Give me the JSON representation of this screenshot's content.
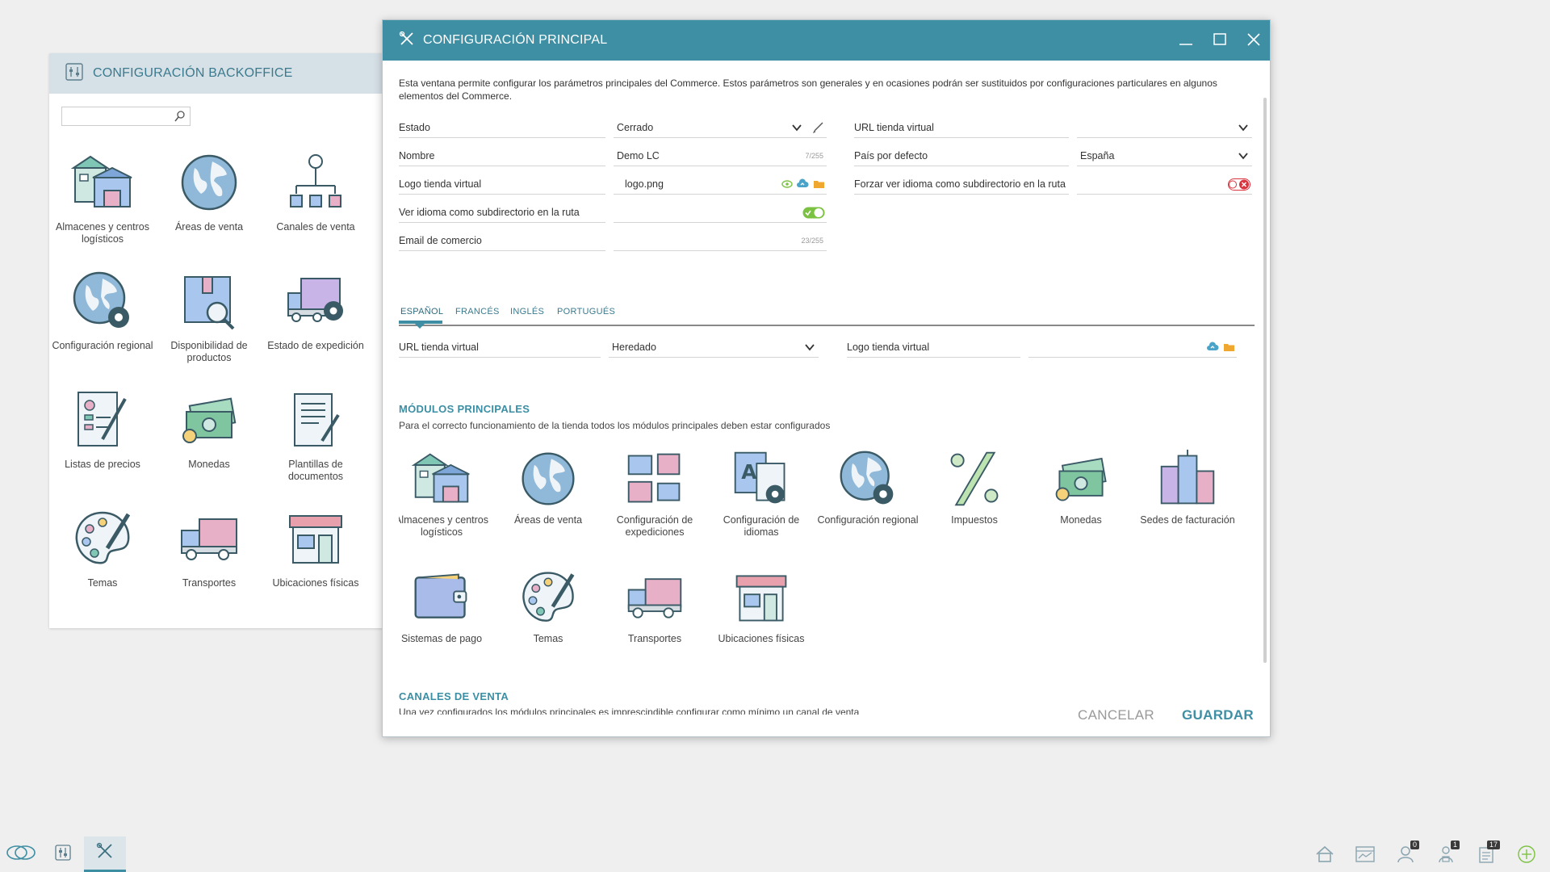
{
  "backoffice": {
    "title": "CONFIGURACIÓN BACKOFFICE",
    "search_placeholder": "",
    "items": [
      {
        "label": "Almacenes y centros logísticos",
        "icon": "warehouse-icon"
      },
      {
        "label": "Áreas de venta",
        "icon": "globe-icon"
      },
      {
        "label": "Canales de venta",
        "icon": "channels-icon"
      },
      {
        "label": "Configuración regional",
        "icon": "globe-gear-icon"
      },
      {
        "label": "Disponibilidad de productos",
        "icon": "box-search-icon"
      },
      {
        "label": "Estado de expedición",
        "icon": "truck-gear-icon"
      },
      {
        "label": "Listas de precios",
        "icon": "price-list-icon"
      },
      {
        "label": "Monedas",
        "icon": "money-icon"
      },
      {
        "label": "Plantillas de documentos",
        "icon": "document-template-icon"
      },
      {
        "label": "Temas",
        "icon": "palette-icon"
      },
      {
        "label": "Transportes",
        "icon": "truck-icon"
      },
      {
        "label": "Ubicaciones físicas",
        "icon": "store-icon"
      }
    ]
  },
  "dialog": {
    "title": "CONFIGURACIÓN PRINCIPAL",
    "description": "Esta ventana permite configurar los parámetros principales del Commerce. Estos parámetros son generales y en ocasiones podrán ser sustituidos por configuraciones particulares en algunos elementos del Commerce.",
    "fields": {
      "estado_label": "Estado",
      "estado_value": "Cerrado",
      "nombre_label": "Nombre",
      "nombre_value": "Demo LC",
      "nombre_counter": "7/255",
      "logo_label": "Logo tienda virtual",
      "logo_value": "logo.png",
      "ver_idioma_label": "Ver idioma como subdirectorio en la ruta",
      "ver_idioma_on": true,
      "email_label": "Email de comercio",
      "email_value": "",
      "email_counter": "23/255",
      "url_label": "URL tienda virtual",
      "url_value": "",
      "pais_label": "País por defecto",
      "pais_value": "España",
      "forzar_label": "Forzar ver idioma como subdirectorio en la ruta",
      "forzar_on": false
    },
    "tabs": [
      "ESPAÑOL",
      "FRANCÉS",
      "INGLÉS",
      "PORTUGUÉS"
    ],
    "lang_fields": {
      "url_label": "URL tienda virtual",
      "url_value": "Heredado",
      "logo_label": "Logo tienda virtual",
      "logo_value": ""
    },
    "modules": {
      "title": "MÓDULOS PRINCIPALES",
      "description": "Para el correcto funcionamiento de la tienda todos los módulos principales deben estar configurados",
      "items": [
        {
          "label": "Almacenes y centros logísticos",
          "icon": "warehouse-icon"
        },
        {
          "label": "Áreas de venta",
          "icon": "globe-icon"
        },
        {
          "label": "Configuración de expediciones",
          "icon": "shipping-config-icon"
        },
        {
          "label": "Configuración de idiomas",
          "icon": "language-config-icon"
        },
        {
          "label": "Configuración regional",
          "icon": "globe-gear-icon"
        },
        {
          "label": "Impuestos",
          "icon": "percent-icon"
        },
        {
          "label": "Monedas",
          "icon": "money-icon"
        },
        {
          "label": "Sedes de facturación",
          "icon": "buildings-icon"
        },
        {
          "label": "Sistemas de pago",
          "icon": "wallet-icon"
        },
        {
          "label": "Temas",
          "icon": "palette-icon"
        },
        {
          "label": "Transportes",
          "icon": "truck-icon"
        },
        {
          "label": "Ubicaciones físicas",
          "icon": "store-icon"
        }
      ]
    },
    "channels": {
      "title": "CANALES DE VENTA",
      "description": "Una vez configurados los módulos principales es imprescindible configurar como mínimo un canal de venta"
    },
    "cancel_label": "CANCELAR",
    "save_label": "GUARDAR"
  },
  "taskbar": {
    "badges": {
      "users": "0",
      "clients": "1",
      "notes": "17"
    }
  },
  "colors": {
    "accent": "#3f8fa4",
    "header_bg": "#d6e1e7",
    "toggle_on": "#7cc242",
    "toggle_off": "#d9343f"
  }
}
